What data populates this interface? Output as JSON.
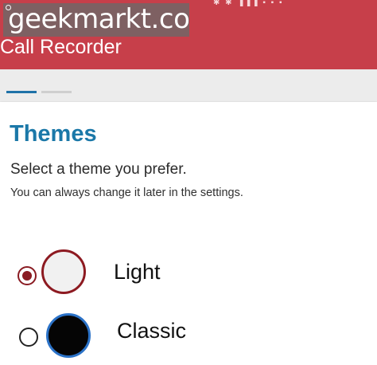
{
  "app": {
    "title": "Call Recorder",
    "status_icons": "✱ ✱ ▐▐▐ ▪ ▪ ▪"
  },
  "watermark": {
    "text": "geekmarkt.com"
  },
  "pager": {
    "active_page": 1,
    "total_pages": 2
  },
  "themes": {
    "title": "Themes",
    "subtitle": "Select a theme you prefer.",
    "hint": "You can always change it later in the settings.",
    "options": [
      {
        "label": "Light",
        "selected": true,
        "swatch_color": "#f1f1f1",
        "border_color": "#8d1a21"
      },
      {
        "label": "Classic",
        "selected": false,
        "swatch_color": "#050505",
        "border_color": "#2b72c7"
      }
    ]
  },
  "colors": {
    "header": "#c73f4a",
    "accent": "#1b78a8",
    "background": "#ececec"
  }
}
